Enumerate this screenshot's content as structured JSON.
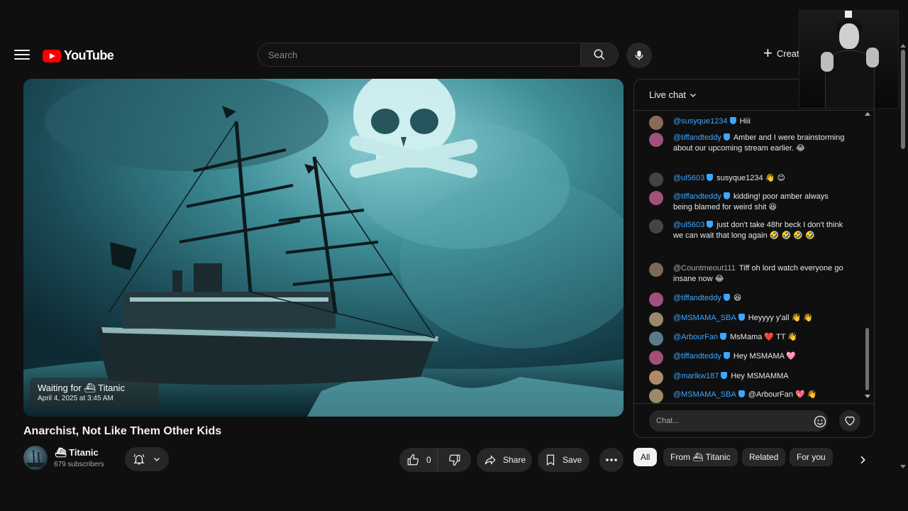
{
  "header": {
    "logo_text": "YouTube",
    "search_placeholder": "Search",
    "create_label": "Create"
  },
  "video": {
    "waiting_title": "Waiting for ⛴ Titanic",
    "waiting_date": "April 4, 2025 at 3:45 AM",
    "title": "Anarchist, Not Like Them Other Kids"
  },
  "channel": {
    "name": "⛴ Titanic",
    "subscribers": "679 subscribers"
  },
  "actions": {
    "like_count": "0",
    "share_label": "Share",
    "save_label": "Save"
  },
  "chat": {
    "header_label": "Live chat",
    "input_placeholder": "Chat...",
    "messages": [
      {
        "author": "@susyque1234",
        "verified": true,
        "text": "Hiii",
        "avatar_color": "#8a6a55"
      },
      {
        "author": "@tiffandteddy",
        "verified": true,
        "text": "Amber and I were brainstorming about our upcoming stream earlier. 😂",
        "avatar_color": "#a0507a"
      },
      {
        "author": "@ul5603",
        "verified": true,
        "text": "susyque1234 👋 😊",
        "avatar_color": "#444444"
      },
      {
        "author": "@tiffandteddy",
        "verified": true,
        "text": "kidding! poor amber always being blamed for weird shit 😆",
        "avatar_color": "#a0507a"
      },
      {
        "author": "@ul5603",
        "verified": true,
        "text": "just don't take 48hr beck I don't think we can wait that long again 🤣 🤣 🤣 🤣",
        "avatar_color": "#444444"
      },
      {
        "author": "@Countmeout111",
        "verified": false,
        "text": "Tiff oh lord watch everyone go insane now 😂",
        "avatar_color": "#7a6a5a"
      },
      {
        "author": "@tiffandteddy",
        "verified": true,
        "text": "😆",
        "avatar_color": "#a0507a"
      },
      {
        "author": "@MSMAMA_SBA",
        "verified": true,
        "text": "Heyyyy y'all 👋 👋",
        "avatar_color": "#9a8a6a"
      },
      {
        "author": "@ArbourFan",
        "verified": true,
        "text": "MsMama ❤️ TT 👋",
        "avatar_color": "#5a7a8a"
      },
      {
        "author": "@tiffandteddy",
        "verified": true,
        "text": "Hey MSMAMA 🩷",
        "avatar_color": "#a0507a"
      },
      {
        "author": "@marikw187",
        "verified": true,
        "text": "Hey MSMAMMA",
        "avatar_color": "#b08a6a"
      },
      {
        "author": "@MSMAMA_SBA",
        "verified": true,
        "text": "@ArbourFan 💖 👋",
        "avatar_color": "#9a8a6a"
      }
    ]
  },
  "chips": [
    {
      "label": "All",
      "active": true
    },
    {
      "label": "From ⛴ Titanic",
      "active": false
    },
    {
      "label": "Related",
      "active": false
    },
    {
      "label": "For you",
      "active": false
    }
  ],
  "colors": {
    "background": "#0f0f0f",
    "brand_red": "#ff0000",
    "link_blue": "#3ea6ff",
    "surface": "#272727"
  },
  "icons": [
    "menu-icon",
    "search-icon",
    "mic-icon",
    "plus-icon",
    "bell-icon",
    "chevron-down-icon",
    "thumbs-up-icon",
    "thumbs-down-icon",
    "share-icon",
    "bookmark-icon",
    "more-icon",
    "emoji-icon",
    "heart-icon",
    "chevron-right-icon"
  ]
}
